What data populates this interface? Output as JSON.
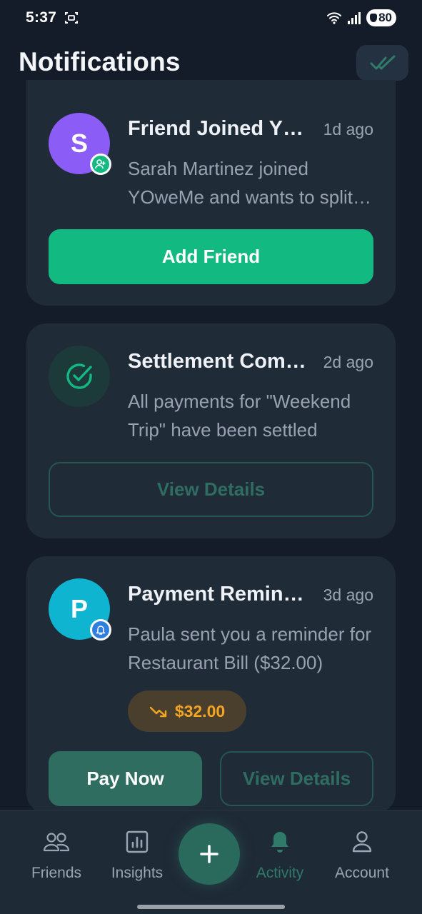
{
  "status_bar": {
    "time": "5:37",
    "battery": "80"
  },
  "header": {
    "title": "Notifications",
    "mark_all_icon": "double-check-icon"
  },
  "notifications": [
    {
      "avatar_letter": "S",
      "badge_icon": "user-plus-icon",
      "title": "Friend Joined YOweMe",
      "time": "1d ago",
      "body": "Sarah Martinez joined YOweMe and wants to split expenses with you",
      "primary_action": "Add Friend"
    },
    {
      "avatar_icon": "check-circle-icon",
      "title": "Settlement Complete",
      "time": "2d ago",
      "body": "All payments for \"Weekend Trip\" have been settled",
      "secondary_action": "View Details"
    },
    {
      "avatar_letter": "P",
      "badge_icon": "bell-icon",
      "title": "Payment Reminder",
      "time": "3d ago",
      "body": "Paula sent you a reminder for Restaurant Bill ($32.00)",
      "amount": "$32.00",
      "amount_icon": "trend-down-icon",
      "primary_action": "Pay Now",
      "secondary_action": "View Details"
    }
  ],
  "bottom_nav": {
    "items": [
      {
        "label": "Friends",
        "icon": "users-icon"
      },
      {
        "label": "Insights",
        "icon": "bar-chart-icon"
      },
      {
        "label": "Activity",
        "icon": "bell-icon",
        "active": true
      },
      {
        "label": "Account",
        "icon": "user-icon"
      }
    ],
    "fab_icon": "plus-icon"
  },
  "colors": {
    "background": "#141c29",
    "card": "#202b38",
    "accent_green": "#12b981",
    "accent_teal_dark": "#2f6d60",
    "amount_orange": "#f5a524",
    "avatar_purple": "#8b5cf6",
    "avatar_cyan": "#0fb4d1"
  }
}
